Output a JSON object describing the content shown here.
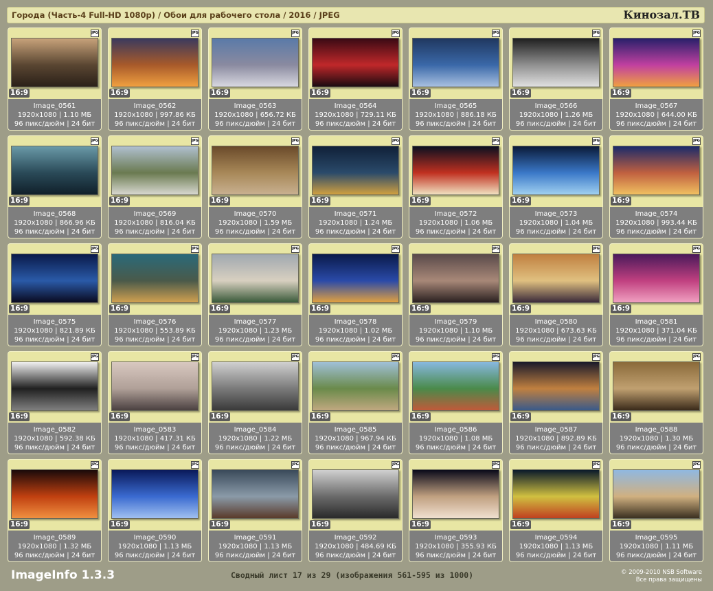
{
  "header": {
    "title": "Города (Часть-4 Full-HD 1080p) / Обои для рабочего стола / 2016 / JPEG",
    "brand": "Кинозал.ТВ"
  },
  "card_common": {
    "format_icon": "JPG",
    "ratio": "16:9",
    "dpi_line": "96 пикс/дюйм | 24 бит"
  },
  "images": [
    {
      "name": "Image_0561",
      "meta": "1920x1080 | 1.10 МБ",
      "thumb": [
        "#c7a27a",
        "#5a4632",
        "#2a2018"
      ]
    },
    {
      "name": "Image_0562",
      "meta": "1920x1080 | 997.86 КБ",
      "thumb": [
        "#3b3a5e",
        "#a85a2a",
        "#f0a040"
      ]
    },
    {
      "name": "Image_0563",
      "meta": "1920x1080 | 656.72 КБ",
      "thumb": [
        "#5a7aa8",
        "#8a8aa0",
        "#d8d8e0"
      ]
    },
    {
      "name": "Image_0564",
      "meta": "1920x1080 | 729.11 КБ",
      "thumb": [
        "#3a0a14",
        "#c0282a",
        "#1a0a10"
      ]
    },
    {
      "name": "Image_0565",
      "meta": "1920x1080 | 886.18 КБ",
      "thumb": [
        "#203860",
        "#3a68a8",
        "#a8c0e0"
      ]
    },
    {
      "name": "Image_0566",
      "meta": "1920x1080 | 1.26 МБ",
      "thumb": [
        "#202020",
        "#909090",
        "#e0e0e0"
      ]
    },
    {
      "name": "Image_0567",
      "meta": "1920x1080 | 644.00 КБ",
      "thumb": [
        "#28206a",
        "#c040a0",
        "#f0a040"
      ]
    },
    {
      "name": "Image_0568",
      "meta": "1920x1080 | 866.96 КБ",
      "thumb": [
        "#6a9aa8",
        "#2a4a58",
        "#10202a"
      ]
    },
    {
      "name": "Image_0569",
      "meta": "1920x1080 | 816.04 КБ",
      "thumb": [
        "#b0c0d0",
        "#6a7a50",
        "#d8d8d0"
      ]
    },
    {
      "name": "Image_0570",
      "meta": "1920x1080 | 1.59 МБ",
      "thumb": [
        "#6a4a2a",
        "#a88858",
        "#c8b090"
      ]
    },
    {
      "name": "Image_0571",
      "meta": "1920x1080 | 1.24 МБ",
      "thumb": [
        "#102038",
        "#2a4a6a",
        "#d0a040"
      ]
    },
    {
      "name": "Image_0572",
      "meta": "1920x1080 | 1.06 МБ",
      "thumb": [
        "#0a1020",
        "#c03020",
        "#f0e0c0"
      ]
    },
    {
      "name": "Image_0573",
      "meta": "1920x1080 | 1.04 МБ",
      "thumb": [
        "#0a1a38",
        "#3a78c8",
        "#a0d0f0"
      ]
    },
    {
      "name": "Image_0574",
      "meta": "1920x1080 | 993.44 КБ",
      "thumb": [
        "#1a2a6a",
        "#c06040",
        "#f0c060"
      ]
    },
    {
      "name": "Image_0575",
      "meta": "1920x1080 | 821.89 КБ",
      "thumb": [
        "#0a1a4a",
        "#2a5aa8",
        "#0a0a20"
      ]
    },
    {
      "name": "Image_0576",
      "meta": "1920x1080 | 553.89 КБ",
      "thumb": [
        "#2a6a7a",
        "#4a5a4a",
        "#d0a050"
      ]
    },
    {
      "name": "Image_0577",
      "meta": "1920x1080 | 1.23 МБ",
      "thumb": [
        "#a0a8b0",
        "#d8d0c0",
        "#3a5a3a"
      ]
    },
    {
      "name": "Image_0578",
      "meta": "1920x1080 | 1.02 МБ",
      "thumb": [
        "#0a1a4a",
        "#2a4aa8",
        "#e0a040"
      ]
    },
    {
      "name": "Image_0579",
      "meta": "1920x1080 | 1.10 МБ",
      "thumb": [
        "#5a4a4a",
        "#a88878",
        "#2a2020"
      ]
    },
    {
      "name": "Image_0580",
      "meta": "1920x1080 | 673.63 КБ",
      "thumb": [
        "#c08040",
        "#e0c080",
        "#3a2a3a"
      ]
    },
    {
      "name": "Image_0581",
      "meta": "1920x1080 | 371.04 КБ",
      "thumb": [
        "#4a1a5a",
        "#c04080",
        "#f0a0c0"
      ]
    },
    {
      "name": "Image_0582",
      "meta": "1920x1080 | 592.38 КБ",
      "thumb": [
        "#f0f0f0",
        "#202020",
        "#808080"
      ]
    },
    {
      "name": "Image_0583",
      "meta": "1920x1080 | 417.31 КБ",
      "thumb": [
        "#d8c8c0",
        "#b0a098",
        "#4a4040"
      ]
    },
    {
      "name": "Image_0584",
      "meta": "1920x1080 | 1.22 МБ",
      "thumb": [
        "#d0d0d0",
        "#7a7a7a",
        "#3a3a3a"
      ]
    },
    {
      "name": "Image_0585",
      "meta": "1920x1080 | 967.94 КБ",
      "thumb": [
        "#a0c0d8",
        "#6a8a4a",
        "#c0a880"
      ]
    },
    {
      "name": "Image_0586",
      "meta": "1920x1080 | 1.08 МБ",
      "thumb": [
        "#88b8e0",
        "#4a8a4a",
        "#c05a3a"
      ]
    },
    {
      "name": "Image_0587",
      "meta": "1920x1080 | 892.89 КБ",
      "thumb": [
        "#1a1a2a",
        "#c08040",
        "#3a5a8a"
      ]
    },
    {
      "name": "Image_0588",
      "meta": "1920x1080 | 1.30 МБ",
      "thumb": [
        "#8a6a3a",
        "#c0a070",
        "#3a2a1a"
      ]
    },
    {
      "name": "Image_0589",
      "meta": "1920x1080 | 1.32 МБ",
      "thumb": [
        "#1a0a0a",
        "#c04010",
        "#f09040"
      ]
    },
    {
      "name": "Image_0590",
      "meta": "1920x1080 | 1.13 МБ",
      "thumb": [
        "#0a1a5a",
        "#3a6ad0",
        "#a0c0f0"
      ]
    },
    {
      "name": "Image_0591",
      "meta": "1920x1080 | 1.13 МБ",
      "thumb": [
        "#3a4a5a",
        "#8a9aa8",
        "#5a3a2a"
      ]
    },
    {
      "name": "Image_0592",
      "meta": "1920x1080 | 484.69 КБ",
      "thumb": [
        "#d0d0d0",
        "#6a6a6a",
        "#2a2a2a"
      ]
    },
    {
      "name": "Image_0593",
      "meta": "1920x1080 | 355.93 КБ",
      "thumb": [
        "#0a0a1a",
        "#c0a080",
        "#f0e0d0"
      ]
    },
    {
      "name": "Image_0594",
      "meta": "1920x1080 | 1.13 МБ",
      "thumb": [
        "#0a1a2a",
        "#d0c040",
        "#c04020"
      ]
    },
    {
      "name": "Image_0595",
      "meta": "1920x1080 | 1.11 МБ",
      "thumb": [
        "#90b8e0",
        "#d0b080",
        "#3a3020"
      ]
    }
  ],
  "footer": {
    "app": "ImageInfo 1.3.3",
    "summary": "Сводный лист 17 из 29 (изображения 561-595 из 1000)",
    "copyright": "© 2009-2010 NSB Software",
    "rights": "Все права защищены"
  }
}
